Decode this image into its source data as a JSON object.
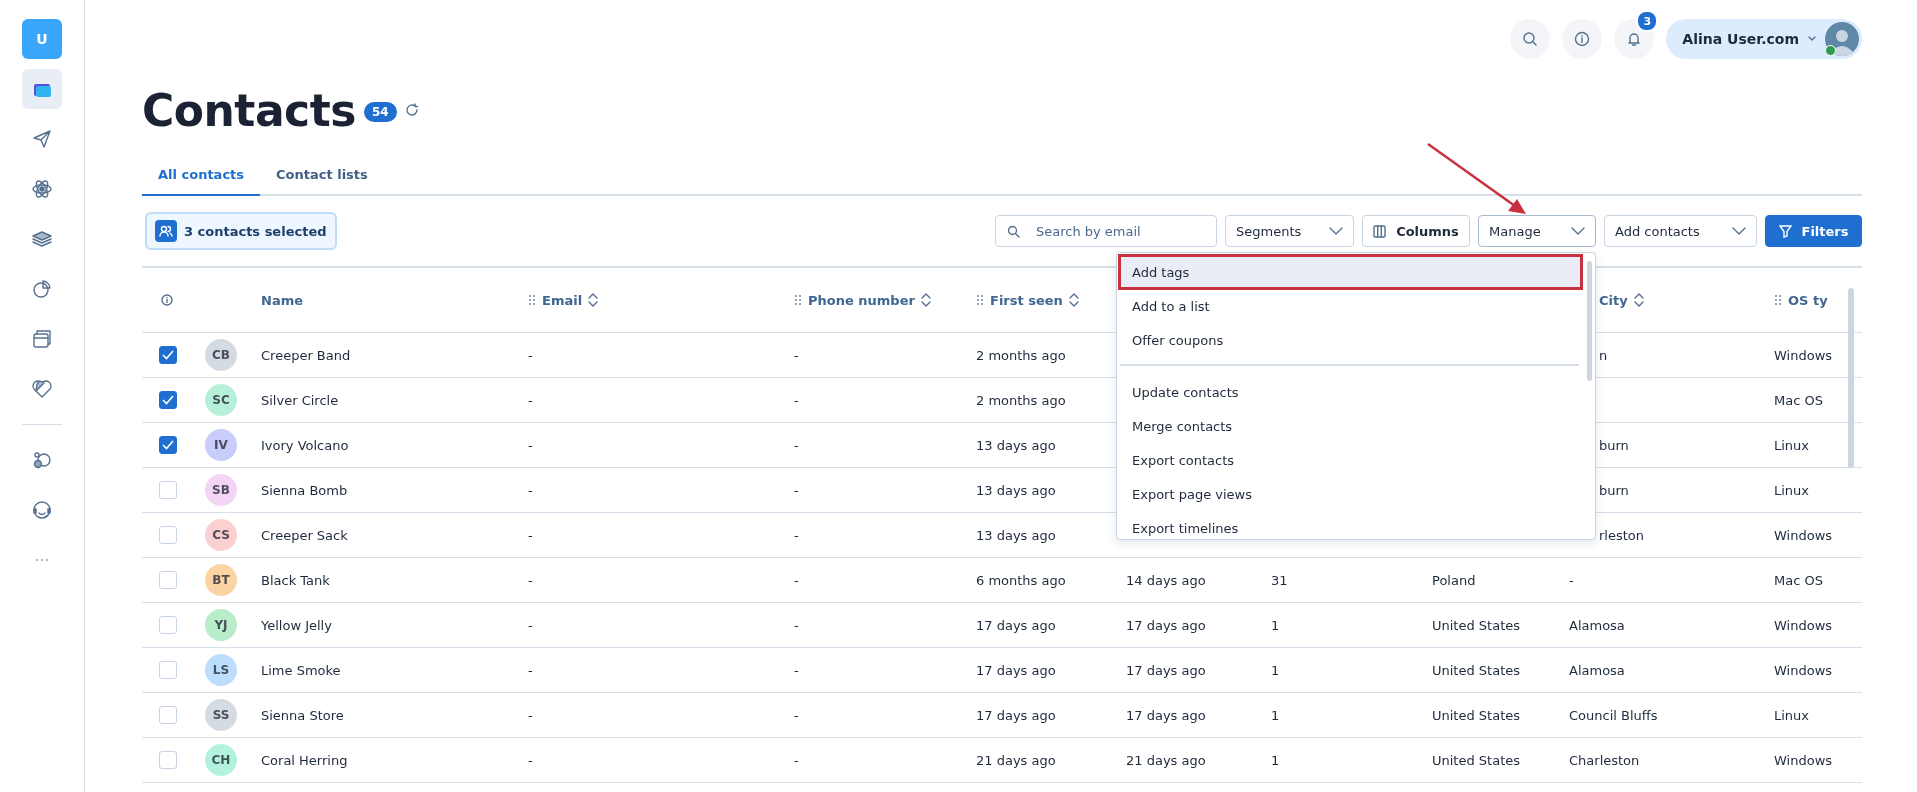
{
  "sidebar": {
    "logo": "U",
    "items": [
      {
        "selected": true
      },
      {
        "selected": false
      },
      {
        "selected": false
      },
      {
        "selected": false
      },
      {
        "selected": false
      },
      {
        "selected": false
      },
      {
        "selected": false
      }
    ],
    "bottom_items": [
      {
        "selected": false
      },
      {
        "selected": false
      }
    ]
  },
  "top_bar": {
    "notifications_badge": "3",
    "user": {
      "name": "Alina User.com",
      "online": true
    }
  },
  "page": {
    "title": "Contacts",
    "count": "54"
  },
  "tabs": [
    {
      "label": "All contacts",
      "selected": true
    },
    {
      "label": "Contact lists",
      "selected": false
    }
  ],
  "selection": {
    "label": "3 contacts selected"
  },
  "toolbar": {
    "search": {
      "placeholder": "Search by email"
    },
    "buttons": [
      {
        "label": "Segments",
        "kind": "dropdown",
        "expanded": false
      },
      {
        "label": "Columns",
        "kind": "columns"
      },
      {
        "label": "Manage",
        "kind": "dropdown",
        "expanded": true
      },
      {
        "label": "Add contacts",
        "kind": "dropdown",
        "expanded": false
      },
      {
        "label": "Filters",
        "kind": "primary"
      }
    ]
  },
  "manage_menu": {
    "groups": [
      [
        {
          "label": "Add tags",
          "hovered": true,
          "highlighted": true
        },
        {
          "label": "Add to a list",
          "hovered": false,
          "highlighted": false
        },
        {
          "label": "Offer coupons",
          "hovered": false,
          "highlighted": false
        }
      ],
      [
        {
          "label": "Update contacts",
          "hovered": false,
          "highlighted": false
        },
        {
          "label": "Merge contacts",
          "hovered": false,
          "highlighted": false
        },
        {
          "label": "Export contacts",
          "hovered": false,
          "highlighted": false
        },
        {
          "label": "Export page views",
          "hovered": false,
          "highlighted": false
        },
        {
          "label": "Export timelines",
          "hovered": false,
          "highlighted": false
        }
      ]
    ]
  },
  "annotations": [
    {
      "kind": "arrow"
    }
  ],
  "table": {
    "headers": {
      "name": {
        "label": "Name",
        "draggable": false,
        "sortable": false
      },
      "email": {
        "label": "Email",
        "draggable": true,
        "sortable": true
      },
      "phone": {
        "label": "Phone number",
        "draggable": true,
        "sortable": true
      },
      "first_seen": {
        "label": "First seen",
        "draggable": true,
        "sortable": true
      },
      "city": {
        "label": "City",
        "draggable": false,
        "sortable": true
      },
      "os_type": {
        "label": "OS ty",
        "draggable": true,
        "sortable": false
      }
    },
    "rows": [
      {
        "checked": true,
        "initials": "CB",
        "color": "#d5dbe3",
        "name": "Creeper Band",
        "email": "-",
        "phone": "-",
        "first_seen": "2 months ago",
        "city": "n",
        "os_type": "Windows"
      },
      {
        "checked": true,
        "initials": "SC",
        "color": "#b6f0d9",
        "name": "Silver Circle",
        "email": "-",
        "phone": "-",
        "first_seen": "2 months ago",
        "os_type": "Mac OS"
      },
      {
        "checked": true,
        "initials": "IV",
        "color": "#c9cdfb",
        "name": "Ivory Volcano",
        "email": "-",
        "phone": "-",
        "first_seen": "13 days ago",
        "city": "burn",
        "os_type": "Linux"
      },
      {
        "checked": false,
        "initials": "SB",
        "color": "#f4d4f5",
        "name": "Sienna Bomb",
        "email": "-",
        "phone": "-",
        "first_seen": "13 days ago",
        "city": "burn",
        "os_type": "Linux"
      },
      {
        "checked": false,
        "initials": "CS",
        "color": "#fbd0d0",
        "name": "Creeper Sack",
        "email": "-",
        "phone": "-",
        "first_seen": "13 days ago",
        "city": "rleston",
        "os_type": "Windows"
      },
      {
        "checked": false,
        "initials": "BT",
        "color": "#fcd4a4",
        "name": "Black Tank",
        "email": "-",
        "phone": "-",
        "first_seen": "6 months ago",
        "column_5": "14 days ago",
        "column_6": "31",
        "column_7": "Poland",
        "city": "-",
        "os_type": "Mac OS"
      },
      {
        "checked": false,
        "initials": "YJ",
        "color": "#b9ecc9",
        "name": "Yellow Jelly",
        "email": "-",
        "phone": "-",
        "first_seen": "17 days ago",
        "column_5": "17 days ago",
        "column_6": "1",
        "column_7": "United States",
        "city": "Alamosa",
        "os_type": "Windows"
      },
      {
        "checked": false,
        "initials": "LS",
        "color": "#bcdefc",
        "name": "Lime Smoke",
        "email": "-",
        "phone": "-",
        "first_seen": "17 days ago",
        "column_5": "17 days ago",
        "column_6": "1",
        "column_7": "United States",
        "city": "Alamosa",
        "os_type": "Windows"
      },
      {
        "checked": false,
        "initials": "SS",
        "color": "#d5dbe3",
        "name": "Sienna Store",
        "email": "-",
        "phone": "-",
        "first_seen": "17 days ago",
        "column_5": "17 days ago",
        "column_6": "1",
        "column_7": "United States",
        "city": "Council Bluffs",
        "os_type": "Linux"
      },
      {
        "checked": false,
        "initials": "CH",
        "color": "#b3f2dc",
        "name": "Coral Herring",
        "email": "-",
        "phone": "-",
        "first_seen": "21 days ago",
        "column_5": "21 days ago",
        "column_6": "1",
        "column_7": "United States",
        "city": "Charleston",
        "os_type": "Windows"
      }
    ]
  }
}
